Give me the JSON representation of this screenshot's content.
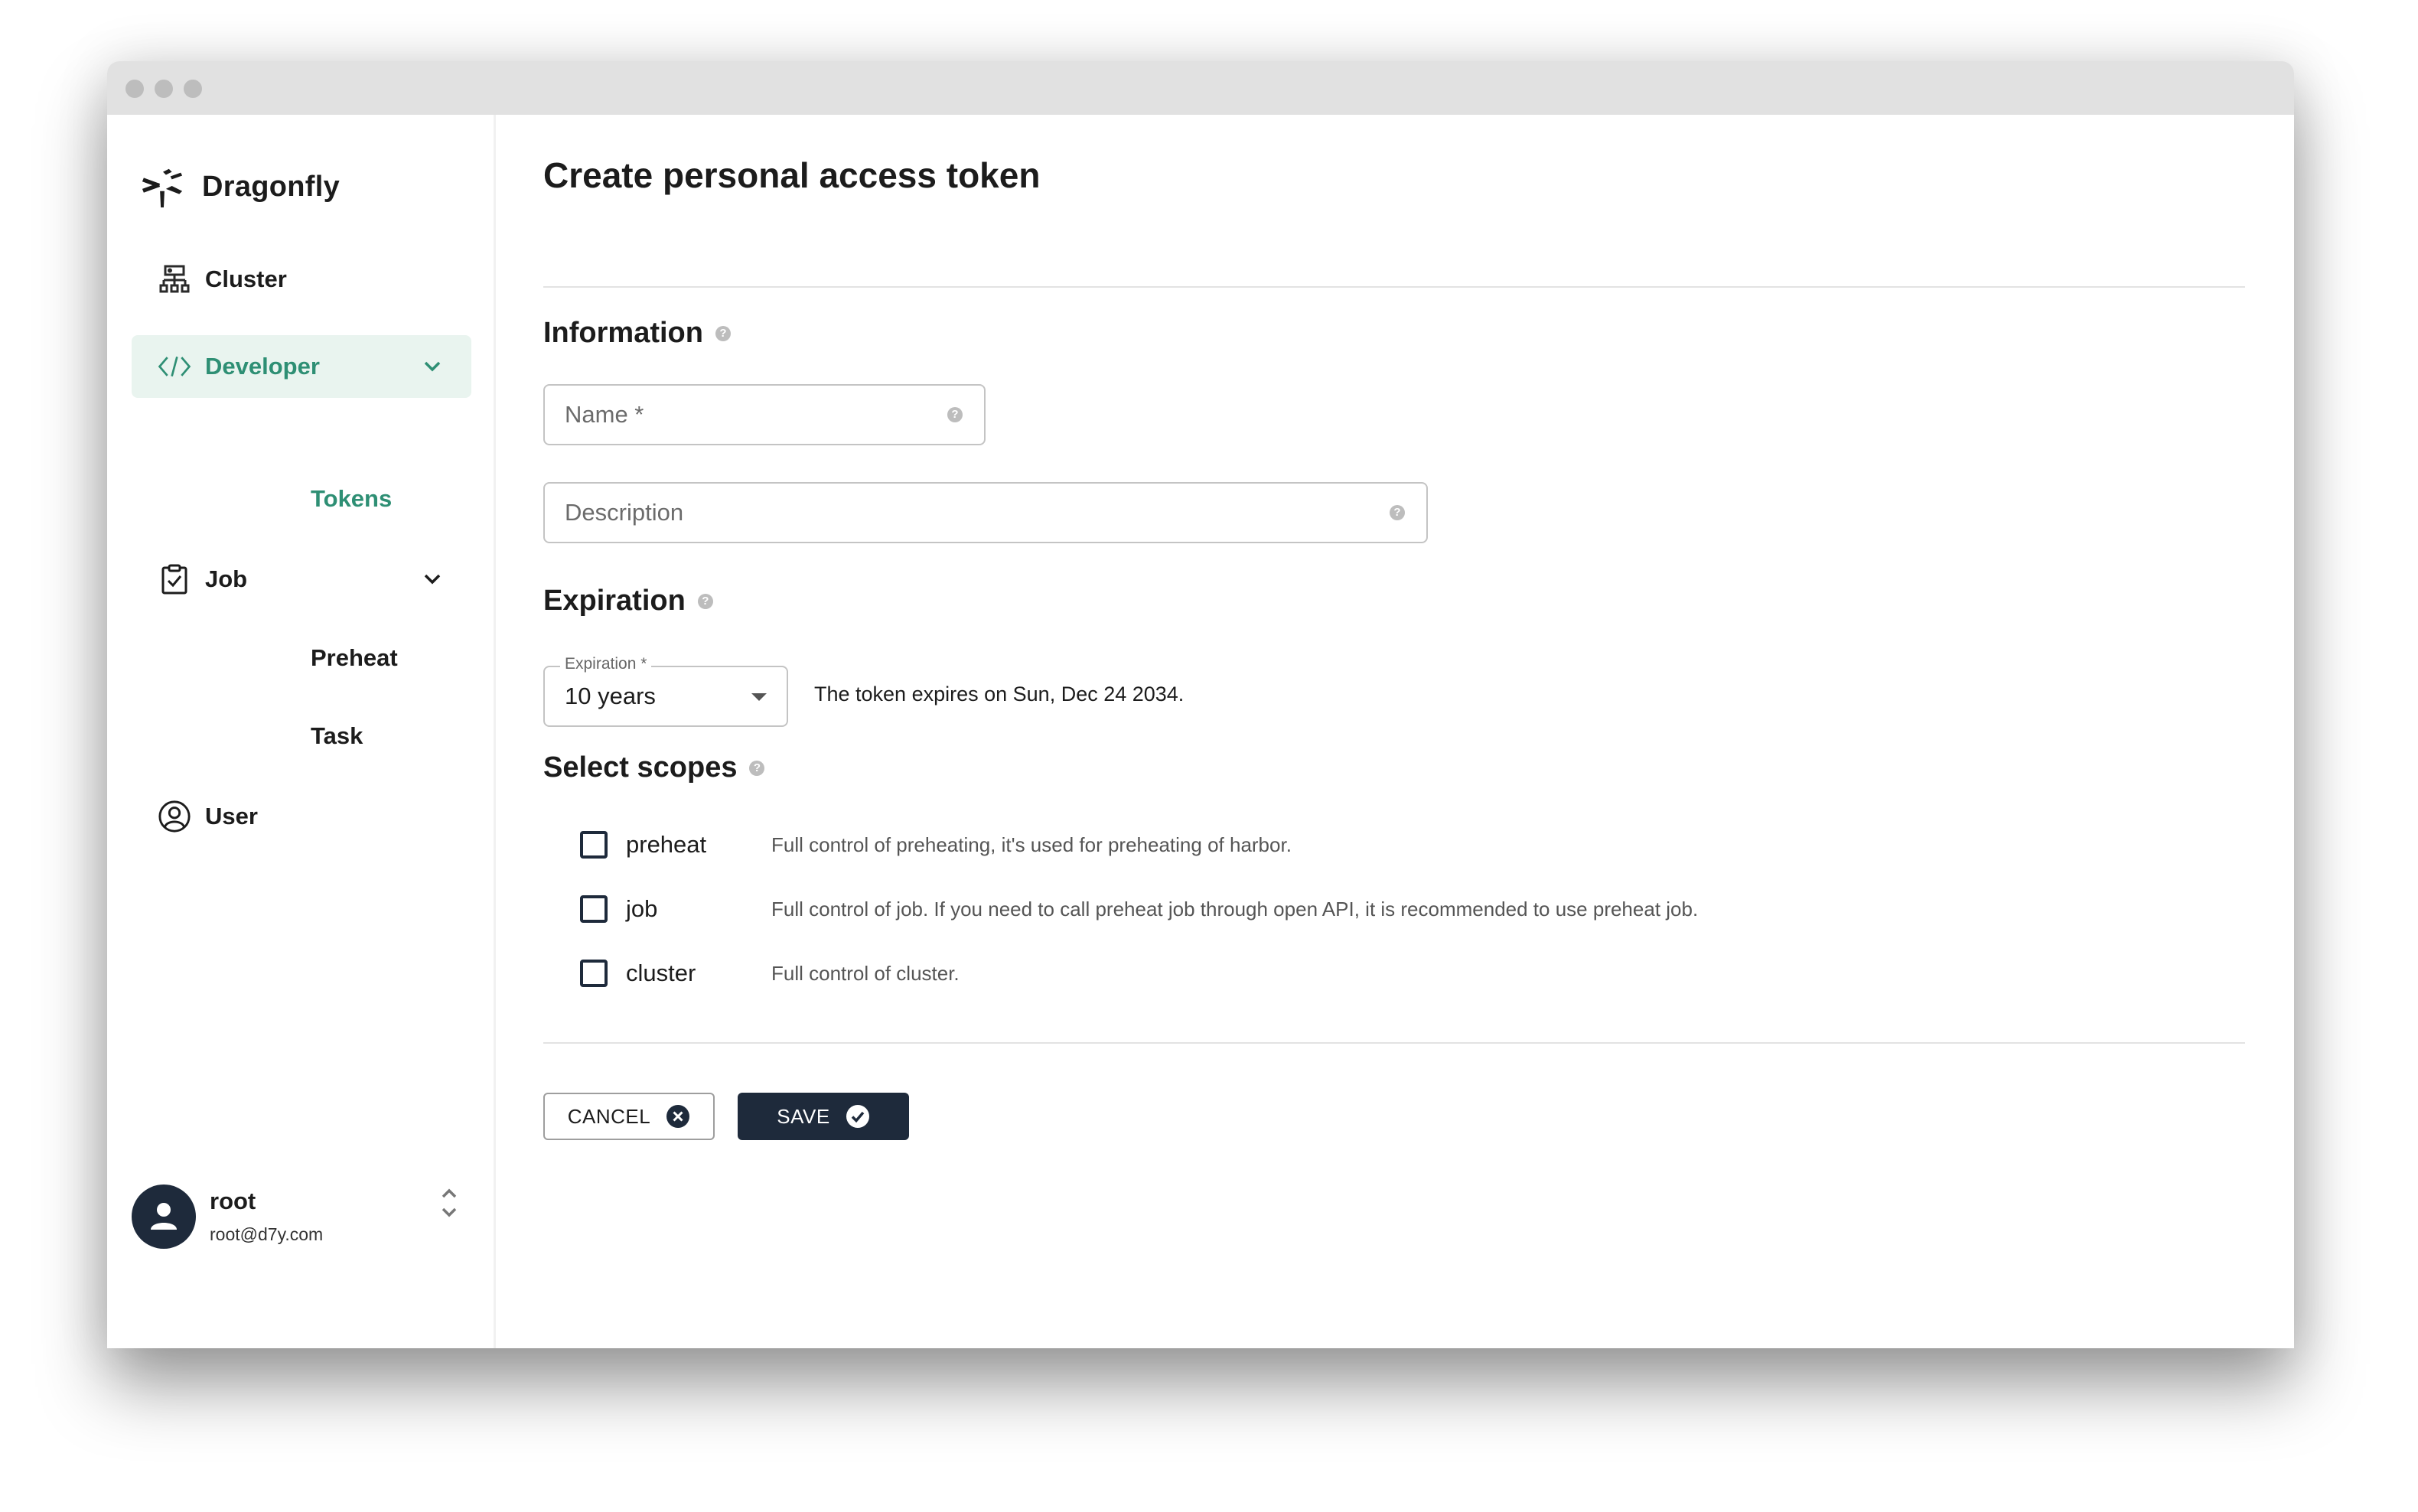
{
  "app": {
    "brand": "Dragonfly"
  },
  "sidebar": {
    "items": [
      {
        "label": "Cluster",
        "icon": "cluster-icon"
      },
      {
        "label": "Developer",
        "icon": "code-icon",
        "active": true,
        "expanded": true
      },
      {
        "label": "Tokens",
        "sub": true,
        "active": true
      },
      {
        "label": "Job",
        "icon": "clipboard-check-icon",
        "expanded": true
      },
      {
        "label": "Preheat",
        "sub": true
      },
      {
        "label": "Task",
        "sub": true
      },
      {
        "label": "User",
        "icon": "user-circle-icon"
      }
    ],
    "user": {
      "name": "root",
      "email": "root@d7y.com"
    }
  },
  "main": {
    "title": "Create personal access token",
    "information": {
      "heading": "Information",
      "name_placeholder": "Name *",
      "name_value": "",
      "description_placeholder": "Description",
      "description_value": ""
    },
    "expiration": {
      "heading": "Expiration",
      "select_label": "Expiration *",
      "selected": "10 years",
      "note": "The token expires on Sun, Dec 24 2034."
    },
    "scopes": {
      "heading": "Select scopes",
      "items": [
        {
          "name": "preheat",
          "checked": false,
          "description": "Full control of preheating, it's used for preheating of harbor."
        },
        {
          "name": "job",
          "checked": false,
          "description": "Full control of job. If you need to call preheat job through open API, it is recommended to use preheat job."
        },
        {
          "name": "cluster",
          "checked": false,
          "description": "Full control of cluster."
        }
      ]
    },
    "actions": {
      "cancel_label": "CANCEL",
      "save_label": "SAVE"
    }
  },
  "colors": {
    "accent": "#2e8f74",
    "accent_bg": "#e9f4ef",
    "primary_dark": "#1e2a3b"
  }
}
